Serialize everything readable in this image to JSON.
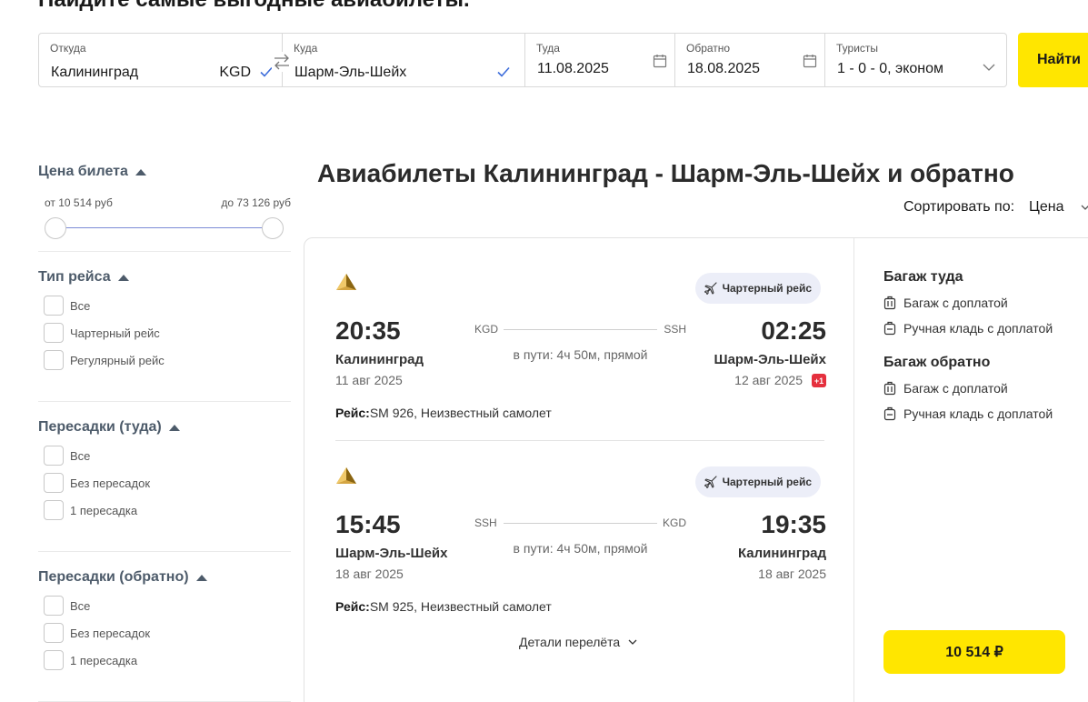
{
  "page": {
    "heading": "Найдите самые выгодные авиабилеты."
  },
  "search": {
    "from": {
      "label": "Откуда",
      "value": "Калининград",
      "code": "KGD"
    },
    "to": {
      "label": "Куда",
      "value": "Шарм-Эль-Шейх"
    },
    "depart": {
      "label": "Туда",
      "value": "11.08.2025"
    },
    "return": {
      "label": "Обратно",
      "value": "18.08.2025"
    },
    "tourists": {
      "label": "Туристы",
      "value": "1 - 0 - 0, эконом"
    },
    "find_label": "Найти",
    "accent_color": "#ffe600",
    "check_color": "#3d6ddb"
  },
  "filters": {
    "price": {
      "title": "Цена билета",
      "min_label": "от 10 514 руб",
      "max_label": "до 73 126 руб"
    },
    "flight_type": {
      "title": "Тип рейса",
      "options": [
        "Все",
        "Чартерный рейс",
        "Регулярный рейс"
      ]
    },
    "stops_out": {
      "title": "Пересадки (туда)",
      "options": [
        "Все",
        "Без пересадок",
        "1 пересадка"
      ]
    },
    "stops_back": {
      "title": "Пересадки (обратно)",
      "options": [
        "Все",
        "Без пересадок",
        "1 пересадка"
      ]
    }
  },
  "results": {
    "title": "Авиабилеты Калининград - Шарм-Эль-Шейх и обратно",
    "sort_label": "Сортировать по:",
    "sort_value": "Цена"
  },
  "offer": {
    "outbound": {
      "badge": "Чартерный рейс",
      "dep_time": "20:35",
      "arr_time": "02:25",
      "dep_city": "Калининград",
      "arr_city": "Шарм-Эль-Шейх",
      "dep_date": "11 авг 2025",
      "arr_date": "12 авг 2025",
      "day_shift": "+1",
      "dep_code": "KGD",
      "arr_code": "SSH",
      "duration": "в пути: 4ч 50м, прямой",
      "flight_label": "Рейс:",
      "flight_value": "SM 926, Неизвестный самолет"
    },
    "inbound": {
      "badge": "Чартерный рейс",
      "dep_time": "15:45",
      "arr_time": "19:35",
      "dep_city": "Шарм-Эль-Шейх",
      "arr_city": "Калининград",
      "dep_date": "18 авг 2025",
      "arr_date": "18 авг 2025",
      "dep_code": "SSH",
      "arr_code": "KGD",
      "duration": "в пути: 4ч 50м, прямой",
      "flight_label": "Рейс:",
      "flight_value": "SM 925, Неизвестный самолет"
    },
    "details_label": "Детали перелёта",
    "baggage_out": {
      "title": "Багаж туда",
      "checked": "Багаж с доплатой",
      "carry_on": "Ручная кладь с доплатой"
    },
    "baggage_back": {
      "title": "Багаж обратно",
      "checked": "Багаж с доплатой",
      "carry_on": "Ручная кладь с доплатой"
    },
    "price": "10 514 ₽"
  }
}
